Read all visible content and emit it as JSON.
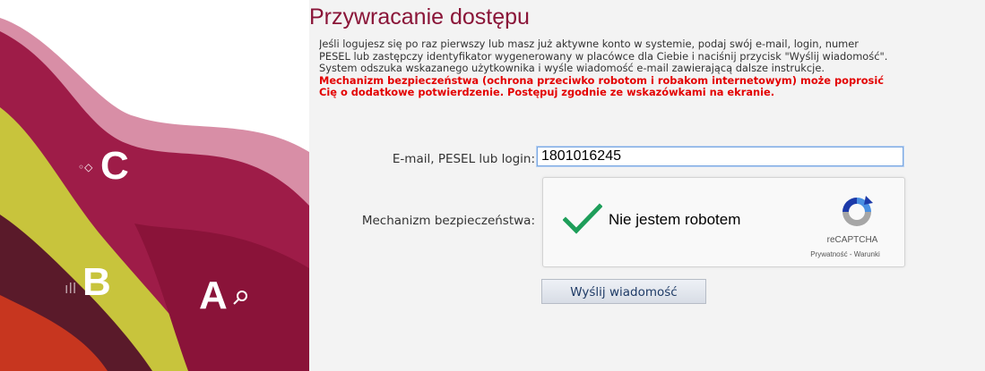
{
  "page": {
    "title": "Przywracanie dostępu",
    "intro": [
      "Jeśli logujesz się po raz pierwszy lub masz już aktywne konto w systemie, podaj swój e-mail, login, numer",
      "PESEL lub zastępczy identyfikator wygenerowany w placówce dla Ciebie i naciśnij przycisk \"Wyślij wiadomość\".",
      "System odszuka wskazanego użytkownika i wyśle wiadomość e-mail zawierającą dalsze instrukcje."
    ],
    "warning": [
      "Mechanizm bezpieczeństwa (ochrona przeciwko robotom i robakom internetowym) może poprosić",
      "Cię o dodatkowe potwierdzenie. Postępuj zgodnie ze wskazówkami na ekranie."
    ]
  },
  "form": {
    "email_label": "E-mail, PESEL lub login:",
    "email_value": "1801016245",
    "security_label": "Mechanizm bezpieczeństwa:",
    "submit_label": "Wyślij wiadomość"
  },
  "captcha": {
    "text": "Nie jestem robotem",
    "brand": "reCAPTCHA",
    "terms": "Prywatność - Warunki",
    "checked": true
  },
  "art": {
    "letter_c": "C",
    "letter_b": "B",
    "letter_a": "A"
  },
  "colors": {
    "title": "#8a1538",
    "warning": "#e30000",
    "panel": "#f3f3f3",
    "check": "#1e9e5a"
  }
}
